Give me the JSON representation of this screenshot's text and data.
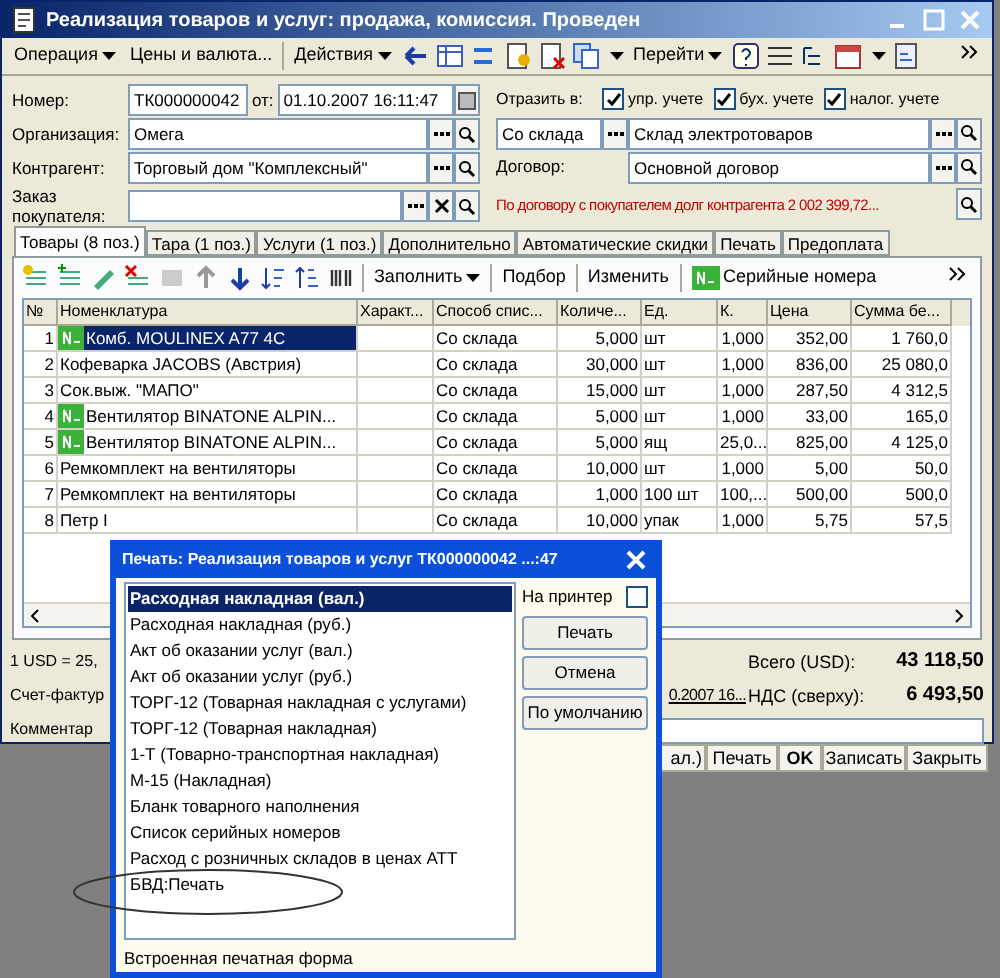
{
  "window": {
    "title": "Реализация товаров и услуг: продажа, комиссия. Проведен"
  },
  "toolbar": {
    "menus": [
      {
        "label": "Операция",
        "dropdown": true
      },
      {
        "label": "Цены и валюта...",
        "dropdown": false
      },
      {
        "label": "Действия",
        "dropdown": true
      },
      {
        "label": "Перейти",
        "dropdown": true
      }
    ]
  },
  "form": {
    "number_label": "Номер:",
    "number": "ТК000000042",
    "date_label": "от:",
    "date": "01.10.2007 16:11:47",
    "organization_label": "Организация:",
    "organization": "Омега",
    "counterparty_label": "Контрагент:",
    "counterparty": "Торговый дом \"Комплексный\"",
    "order_label": "Заказ покупателя:",
    "reflect_label": "Отразить в:",
    "reflect": [
      {
        "label": "упр. учете",
        "checked": true
      },
      {
        "label": "бух. учете",
        "checked": true
      },
      {
        "label": "налог. учете",
        "checked": true
      }
    ],
    "ship_type": "Со склада",
    "warehouse": "Склад электротоваров",
    "contract_label": "Договор:",
    "contract": "Основной договор",
    "debt_notice": "По договору с покупателем долг контрагента 2 002 399,72..."
  },
  "tabs": [
    {
      "label": "Товары (8 поз.)",
      "selected": true
    },
    {
      "label": "Тара (1 поз.)",
      "selected": false
    },
    {
      "label": "Услуги (1 поз.)",
      "selected": false
    },
    {
      "label": "Дополнительно",
      "selected": false
    },
    {
      "label": "Автоматические скидки",
      "selected": false
    },
    {
      "label": "Печать",
      "selected": false
    },
    {
      "label": "Предоплата",
      "selected": false
    }
  ],
  "table_toolbar": {
    "fill": "Заполнить",
    "pick": "Подбор",
    "edit": "Изменить",
    "serials": "Серийные номера"
  },
  "table": {
    "columns": [
      "№",
      "Номенклатура",
      "Характ...",
      "Способ спис...",
      "Количе...",
      "Ед.",
      "К.",
      "Цена",
      "Сумма бе..."
    ],
    "rows": [
      {
        "n": "1",
        "name": "Комб. MOULINEX  A77 4C",
        "serial": true,
        "selected": true,
        "method": "Со склада",
        "qty": "5,000",
        "unit": "шт",
        "k": "1,000",
        "price": "352,00",
        "sum": "1 760,0"
      },
      {
        "n": "2",
        "name": "Кофеварка JACOBS (Австрия)",
        "serial": false,
        "selected": false,
        "method": "Со склада",
        "qty": "30,000",
        "unit": "шт",
        "k": "1,000",
        "price": "836,00",
        "sum": "25 080,0"
      },
      {
        "n": "3",
        "name": "Сок.выж. \"МАПО\"",
        "serial": false,
        "selected": false,
        "method": "Со склада",
        "qty": "15,000",
        "unit": "шт",
        "k": "1,000",
        "price": "287,50",
        "sum": "4 312,5"
      },
      {
        "n": "4",
        "name": "Вентилятор BINATONE ALPIN...",
        "serial": true,
        "selected": false,
        "method": "Со склада",
        "qty": "5,000",
        "unit": "шт",
        "k": "1,000",
        "price": "33,00",
        "sum": "165,0"
      },
      {
        "n": "5",
        "name": "Вентилятор BINATONE ALPIN...",
        "serial": true,
        "selected": false,
        "method": "Со склада",
        "qty": "5,000",
        "unit": "ящ",
        "k": "25,0...",
        "price": "825,00",
        "sum": "4 125,0"
      },
      {
        "n": "6",
        "name": "Ремкомплект на вентиляторы",
        "serial": false,
        "selected": false,
        "method": "Со склада",
        "qty": "10,000",
        "unit": "шт",
        "k": "1,000",
        "price": "5,00",
        "sum": "50,0"
      },
      {
        "n": "7",
        "name": "Ремкомплект на вентиляторы",
        "serial": false,
        "selected": false,
        "method": "Со склада",
        "qty": "1,000",
        "unit": "100 шт",
        "k": "100,...",
        "price": "500,00",
        "sum": "500,0"
      },
      {
        "n": "8",
        "name": "Петр I",
        "serial": false,
        "selected": false,
        "method": "Со склада",
        "qty": "10,000",
        "unit": "упак",
        "k": "1,000",
        "price": "5,75",
        "sum": "57,5"
      }
    ]
  },
  "footer": {
    "rate": "1 USD = 25,",
    "invoice_label": "Счет-фактур",
    "invoice_link": "0.2007 16...",
    "comment_label": "Комментар",
    "total_label": "Всего (USD):",
    "total": "43 118,50",
    "vat_label": "НДС (сверху):",
    "vat": "6 493,50",
    "buttons": [
      {
        "label": "ал.)",
        "bold": false
      },
      {
        "label": "Печать",
        "bold": false
      },
      {
        "label": "OK",
        "bold": true
      },
      {
        "label": "Записать",
        "bold": false
      },
      {
        "label": "Закрыть",
        "bold": false
      }
    ]
  },
  "print_dialog": {
    "title": "Печать: Реализация товаров и услуг ТК000000042 ...:47",
    "forms": [
      {
        "label": "Расходная накладная (вал.)",
        "selected": true
      },
      {
        "label": "Расходная накладная (руб.)",
        "selected": false
      },
      {
        "label": "Акт об оказании услуг (вал.)",
        "selected": false
      },
      {
        "label": "Акт об оказании услуг (руб.)",
        "selected": false
      },
      {
        "label": "ТОРГ-12 (Товарная накладная с услугами)",
        "selected": false
      },
      {
        "label": "ТОРГ-12 (Товарная накладная)",
        "selected": false
      },
      {
        "label": "1-Т (Товарно-транспортная накладная)",
        "selected": false
      },
      {
        "label": "М-15 (Накладная)",
        "selected": false
      },
      {
        "label": "Бланк товарного наполнения",
        "selected": false
      },
      {
        "label": "Список серийных номеров",
        "selected": false
      },
      {
        "label": "Расход с розничных складов в ценах АТТ",
        "selected": false
      },
      {
        "label": "БВД:Печать",
        "selected": false
      }
    ],
    "to_printer": {
      "label": "На принтер",
      "checked": false
    },
    "buttons": [
      "Печать",
      "Отмена",
      "По умолчанию"
    ],
    "status": "Встроенная печатная форма"
  }
}
